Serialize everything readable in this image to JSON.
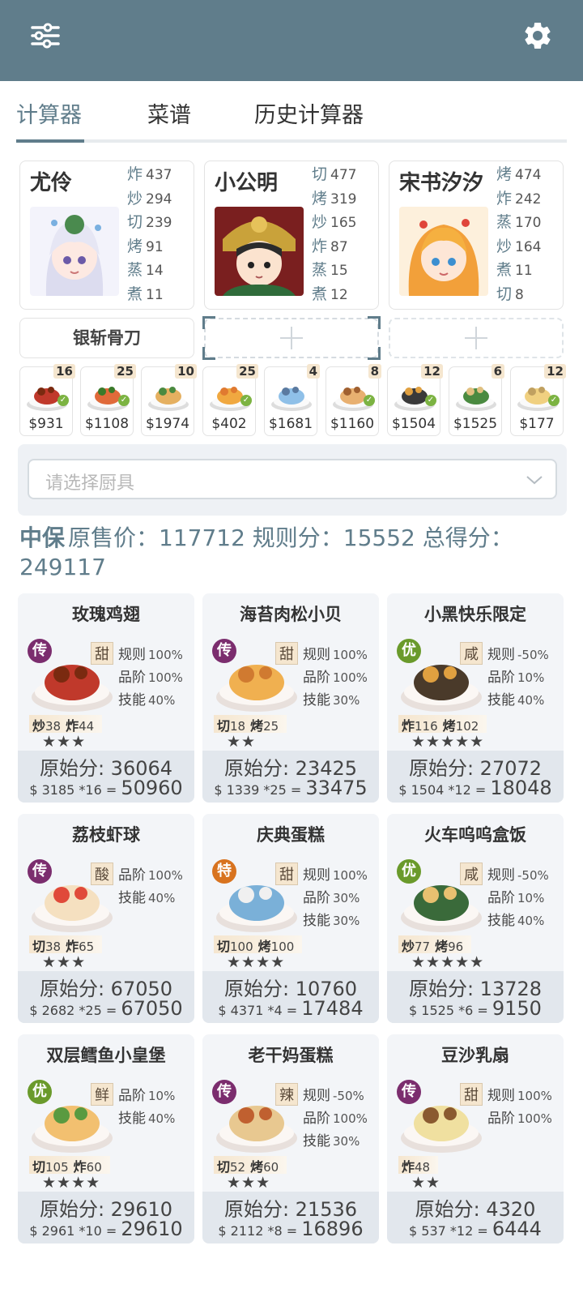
{
  "icons": {
    "menu": "sliders-icon",
    "settings": "gear-icon"
  },
  "tabs": [
    {
      "label": "计算器",
      "active": true
    },
    {
      "label": "菜谱",
      "active": false
    },
    {
      "label": "历史计算器",
      "active": false
    }
  ],
  "chefs": [
    {
      "name": "尤伶",
      "stats": [
        {
          "k": "炸",
          "v": "437"
        },
        {
          "k": "炒",
          "v": "294"
        },
        {
          "k": "切",
          "v": "239"
        },
        {
          "k": "烤",
          "v": "91"
        },
        {
          "k": "蒸",
          "v": "14"
        },
        {
          "k": "煮",
          "v": "11"
        }
      ]
    },
    {
      "name": "小公明",
      "stats": [
        {
          "k": "切",
          "v": "477"
        },
        {
          "k": "烤",
          "v": "319"
        },
        {
          "k": "炒",
          "v": "165"
        },
        {
          "k": "炸",
          "v": "87"
        },
        {
          "k": "蒸",
          "v": "15"
        },
        {
          "k": "煮",
          "v": "12"
        }
      ]
    },
    {
      "name": "宋书汐汐",
      "stats": [
        {
          "k": "烤",
          "v": "474"
        },
        {
          "k": "炸",
          "v": "242"
        },
        {
          "k": "蒸",
          "v": "170"
        },
        {
          "k": "炒",
          "v": "164"
        },
        {
          "k": "煮",
          "v": "11"
        },
        {
          "k": "切",
          "v": "8"
        }
      ]
    }
  ],
  "equipment": {
    "label": "银斩骨刀"
  },
  "selected_recipes": [
    {
      "qty": "16",
      "price": "$931",
      "checked": true
    },
    {
      "qty": "25",
      "price": "$1108",
      "checked": true
    },
    {
      "qty": "10",
      "price": "$1974",
      "checked": false
    },
    {
      "qty": "25",
      "price": "$402",
      "checked": true
    },
    {
      "qty": "4",
      "price": "$1681",
      "checked": false
    },
    {
      "qty": "8",
      "price": "$1160",
      "checked": true
    },
    {
      "qty": "12",
      "price": "$1504",
      "checked": true
    },
    {
      "qty": "6",
      "price": "$1525",
      "checked": false
    },
    {
      "qty": "12",
      "price": "$177",
      "checked": true
    }
  ],
  "kitchenware": {
    "placeholder": "请选择厨具"
  },
  "summary": {
    "title": "中保",
    "text": "原售价：117712 规则分：15552 总得分：249117"
  },
  "dishes": [
    {
      "name": "玫瑰鸡翅",
      "rarity": "传",
      "flavor": "甜",
      "bonuses": [
        {
          "k": "规则",
          "v": "100%"
        },
        {
          "k": "品阶",
          "v": "100%"
        },
        {
          "k": "技能",
          "v": "40%"
        }
      ],
      "skills": [
        {
          "k": "炒",
          "v": "38"
        },
        {
          "k": "炸",
          "v": "44"
        }
      ],
      "stars": "★★★",
      "orig": "原始分: 36064",
      "calc": "$ 3185 *16 =",
      "total": "50960"
    },
    {
      "name": "海苔肉松小贝",
      "rarity": "传",
      "flavor": "甜",
      "bonuses": [
        {
          "k": "规则",
          "v": "100%"
        },
        {
          "k": "品阶",
          "v": "100%"
        },
        {
          "k": "技能",
          "v": "30%"
        }
      ],
      "skills": [
        {
          "k": "切",
          "v": "18"
        },
        {
          "k": "烤",
          "v": "25"
        }
      ],
      "stars": "★★",
      "orig": "原始分: 23425",
      "calc": "$ 1339 *25 =",
      "total": "33475"
    },
    {
      "name": "小黑快乐限定",
      "rarity": "优",
      "flavor": "咸",
      "bonuses": [
        {
          "k": "规则",
          "v": "-50%"
        },
        {
          "k": "品阶",
          "v": "10%"
        },
        {
          "k": "技能",
          "v": "40%"
        }
      ],
      "skills": [
        {
          "k": "炸",
          "v": "116"
        },
        {
          "k": "烤",
          "v": "102"
        }
      ],
      "stars": "★★★★★",
      "orig": "原始分: 27072",
      "calc": "$ 1504 *12 =",
      "total": "18048"
    },
    {
      "name": "荔枝虾球",
      "rarity": "传",
      "flavor": "酸",
      "bonuses": [
        {
          "k": "品阶",
          "v": "100%"
        },
        {
          "k": "技能",
          "v": "40%"
        }
      ],
      "skills": [
        {
          "k": "切",
          "v": "38"
        },
        {
          "k": "炸",
          "v": "65"
        }
      ],
      "stars": "★★★",
      "orig": "原始分: 67050",
      "calc": "$ 2682 *25 =",
      "total": "67050"
    },
    {
      "name": "庆典蛋糕",
      "rarity": "特",
      "flavor": "甜",
      "bonuses": [
        {
          "k": "规则",
          "v": "100%"
        },
        {
          "k": "品阶",
          "v": "30%"
        },
        {
          "k": "技能",
          "v": "30%"
        }
      ],
      "skills": [
        {
          "k": "切",
          "v": "100"
        },
        {
          "k": "烤",
          "v": "100"
        }
      ],
      "stars": "★★★★",
      "orig": "原始分: 10760",
      "calc": "$ 4371 *4 =",
      "total": "17484"
    },
    {
      "name": "火车呜呜盒饭",
      "rarity": "优",
      "flavor": "咸",
      "bonuses": [
        {
          "k": "规则",
          "v": "-50%"
        },
        {
          "k": "品阶",
          "v": "10%"
        },
        {
          "k": "技能",
          "v": "40%"
        }
      ],
      "skills": [
        {
          "k": "炒",
          "v": "77"
        },
        {
          "k": "烤",
          "v": "96"
        }
      ],
      "stars": "★★★★★",
      "orig": "原始分: 13728",
      "calc": "$ 1525 *6 =",
      "total": "9150"
    },
    {
      "name": "双层鳕鱼小皇堡",
      "rarity": "优",
      "flavor": "鲜",
      "bonuses": [
        {
          "k": "品阶",
          "v": "10%"
        },
        {
          "k": "技能",
          "v": "40%"
        }
      ],
      "skills": [
        {
          "k": "切",
          "v": "105"
        },
        {
          "k": "炸",
          "v": "60"
        }
      ],
      "stars": "★★★★",
      "orig": "原始分: 29610",
      "calc": "$ 2961 *10 =",
      "total": "29610"
    },
    {
      "name": "老干妈蛋糕",
      "rarity": "传",
      "flavor": "辣",
      "bonuses": [
        {
          "k": "规则",
          "v": "-50%"
        },
        {
          "k": "品阶",
          "v": "100%"
        },
        {
          "k": "技能",
          "v": "30%"
        }
      ],
      "skills": [
        {
          "k": "切",
          "v": "52"
        },
        {
          "k": "烤",
          "v": "60"
        }
      ],
      "stars": "★★★",
      "orig": "原始分: 21536",
      "calc": "$ 2112 *8 =",
      "total": "16896"
    },
    {
      "name": "豆沙乳扇",
      "rarity": "传",
      "flavor": "甜",
      "bonuses": [
        {
          "k": "规则",
          "v": "100%"
        },
        {
          "k": "品阶",
          "v": "100%"
        }
      ],
      "skills": [
        {
          "k": "炸",
          "v": "48"
        }
      ],
      "stars": "★★",
      "orig": "原始分: 4320",
      "calc": "$ 537 *12 =",
      "total": "6444"
    }
  ],
  "colors": {
    "primary": "#607d8b",
    "rarity_legend": "#7b2d6e",
    "rarity_good": "#6a9a2b",
    "rarity_special": "#d8731f",
    "badge_bg": "#f5e6cf"
  }
}
